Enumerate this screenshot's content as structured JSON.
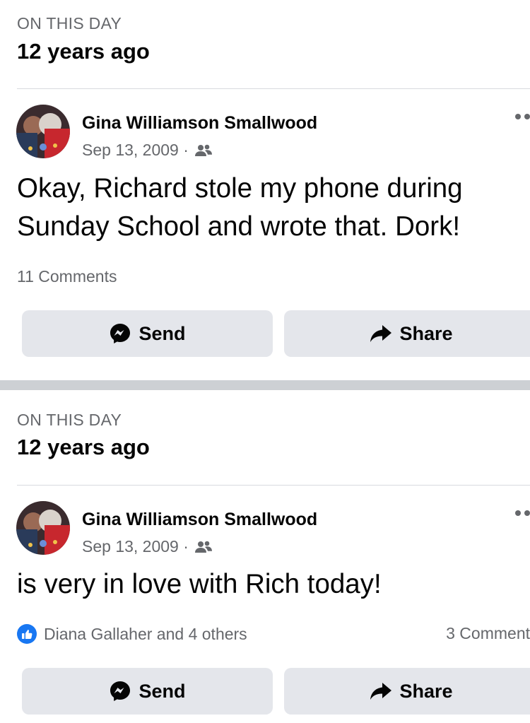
{
  "memories": [
    {
      "kicker": "ON THIS DAY",
      "title": "12 years ago",
      "post": {
        "author": "Gina Williamson Smallwood",
        "date": "Sep 13, 2009 ·",
        "audience_icon": "friends-icon",
        "text": "Okay, Richard stole my phone during Sunday School and wrote that.  Dork!",
        "comments": "11 Comments"
      },
      "actions": {
        "send_label": "Send",
        "share_label": "Share"
      }
    },
    {
      "kicker": "ON THIS DAY",
      "title": "12 years ago",
      "post": {
        "author": "Gina Williamson Smallwood",
        "date": "Sep 13, 2009 ·",
        "audience_icon": "friends-icon",
        "text": "is very in love with Rich today!",
        "reactions": "Diana Gallaher and 4 others",
        "comments": "3 Comment"
      },
      "actions": {
        "send_label": "Send",
        "share_label": "Share"
      }
    }
  ],
  "colors": {
    "accent": "#1877f2",
    "button_bg": "#e4e6eb",
    "secondary_text": "#65676b",
    "separator": "#cdd0d4"
  }
}
